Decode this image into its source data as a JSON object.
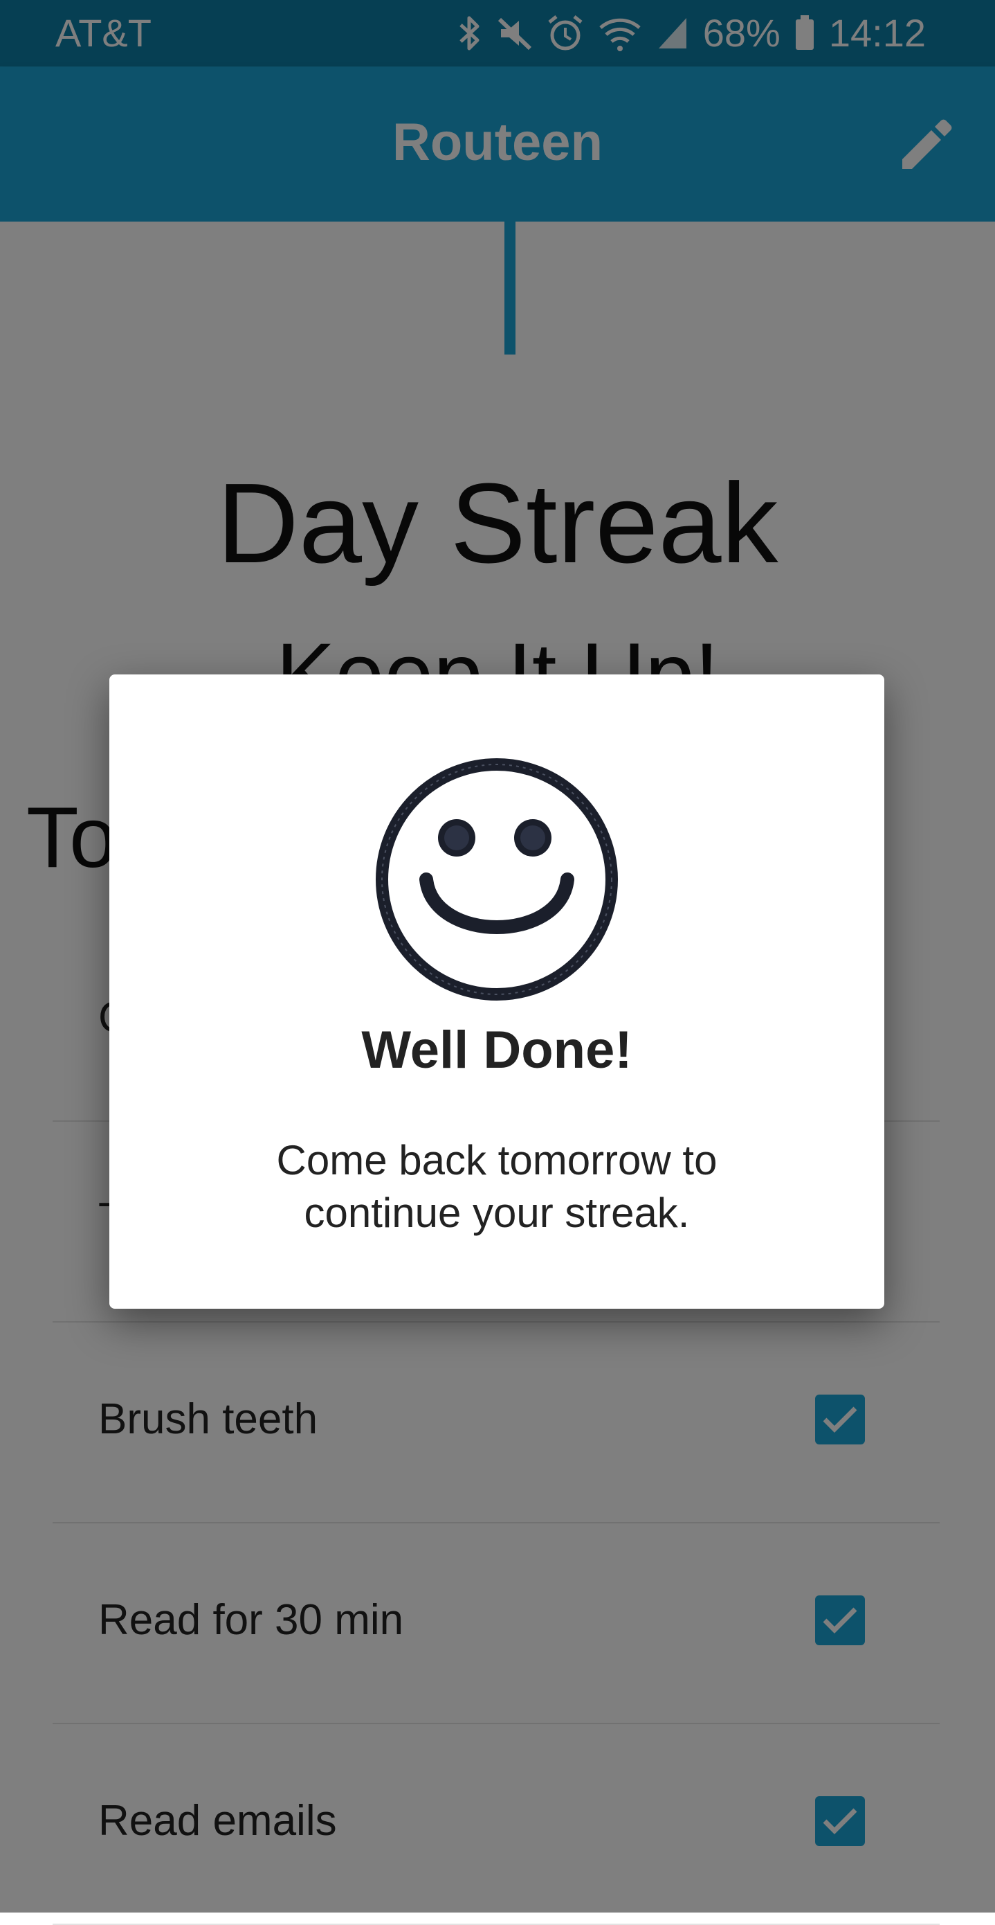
{
  "status_bar": {
    "carrier": "AT&T",
    "battery": "68%",
    "time": "14:12",
    "icons": [
      "bluetooth-icon",
      "muted-icon",
      "alarm-icon",
      "wifi-icon",
      "signal-icon",
      "battery-icon"
    ]
  },
  "app_bar": {
    "title": "Routeen",
    "edit_icon": "pencil-icon"
  },
  "streak": {
    "title": "Day Streak",
    "subtitle": "Keep It Up!"
  },
  "tasks": {
    "heading": "To",
    "items": [
      {
        "label": "C",
        "checked": true
      },
      {
        "label": "T",
        "checked": true
      },
      {
        "label": "Brush teeth",
        "checked": true
      },
      {
        "label": "Read for 30 min",
        "checked": true
      },
      {
        "label": "Read emails",
        "checked": true
      }
    ]
  },
  "dialog": {
    "icon": "smiley-face-icon",
    "title": "Well Done!",
    "message": "Come back tomorrow to continue your streak."
  },
  "colors": {
    "status_bar": "#0d7ea6",
    "app_bar": "#1aa5d6",
    "accent": "#1aa5d6",
    "scrim": "rgba(0,0,0,0.5)"
  }
}
